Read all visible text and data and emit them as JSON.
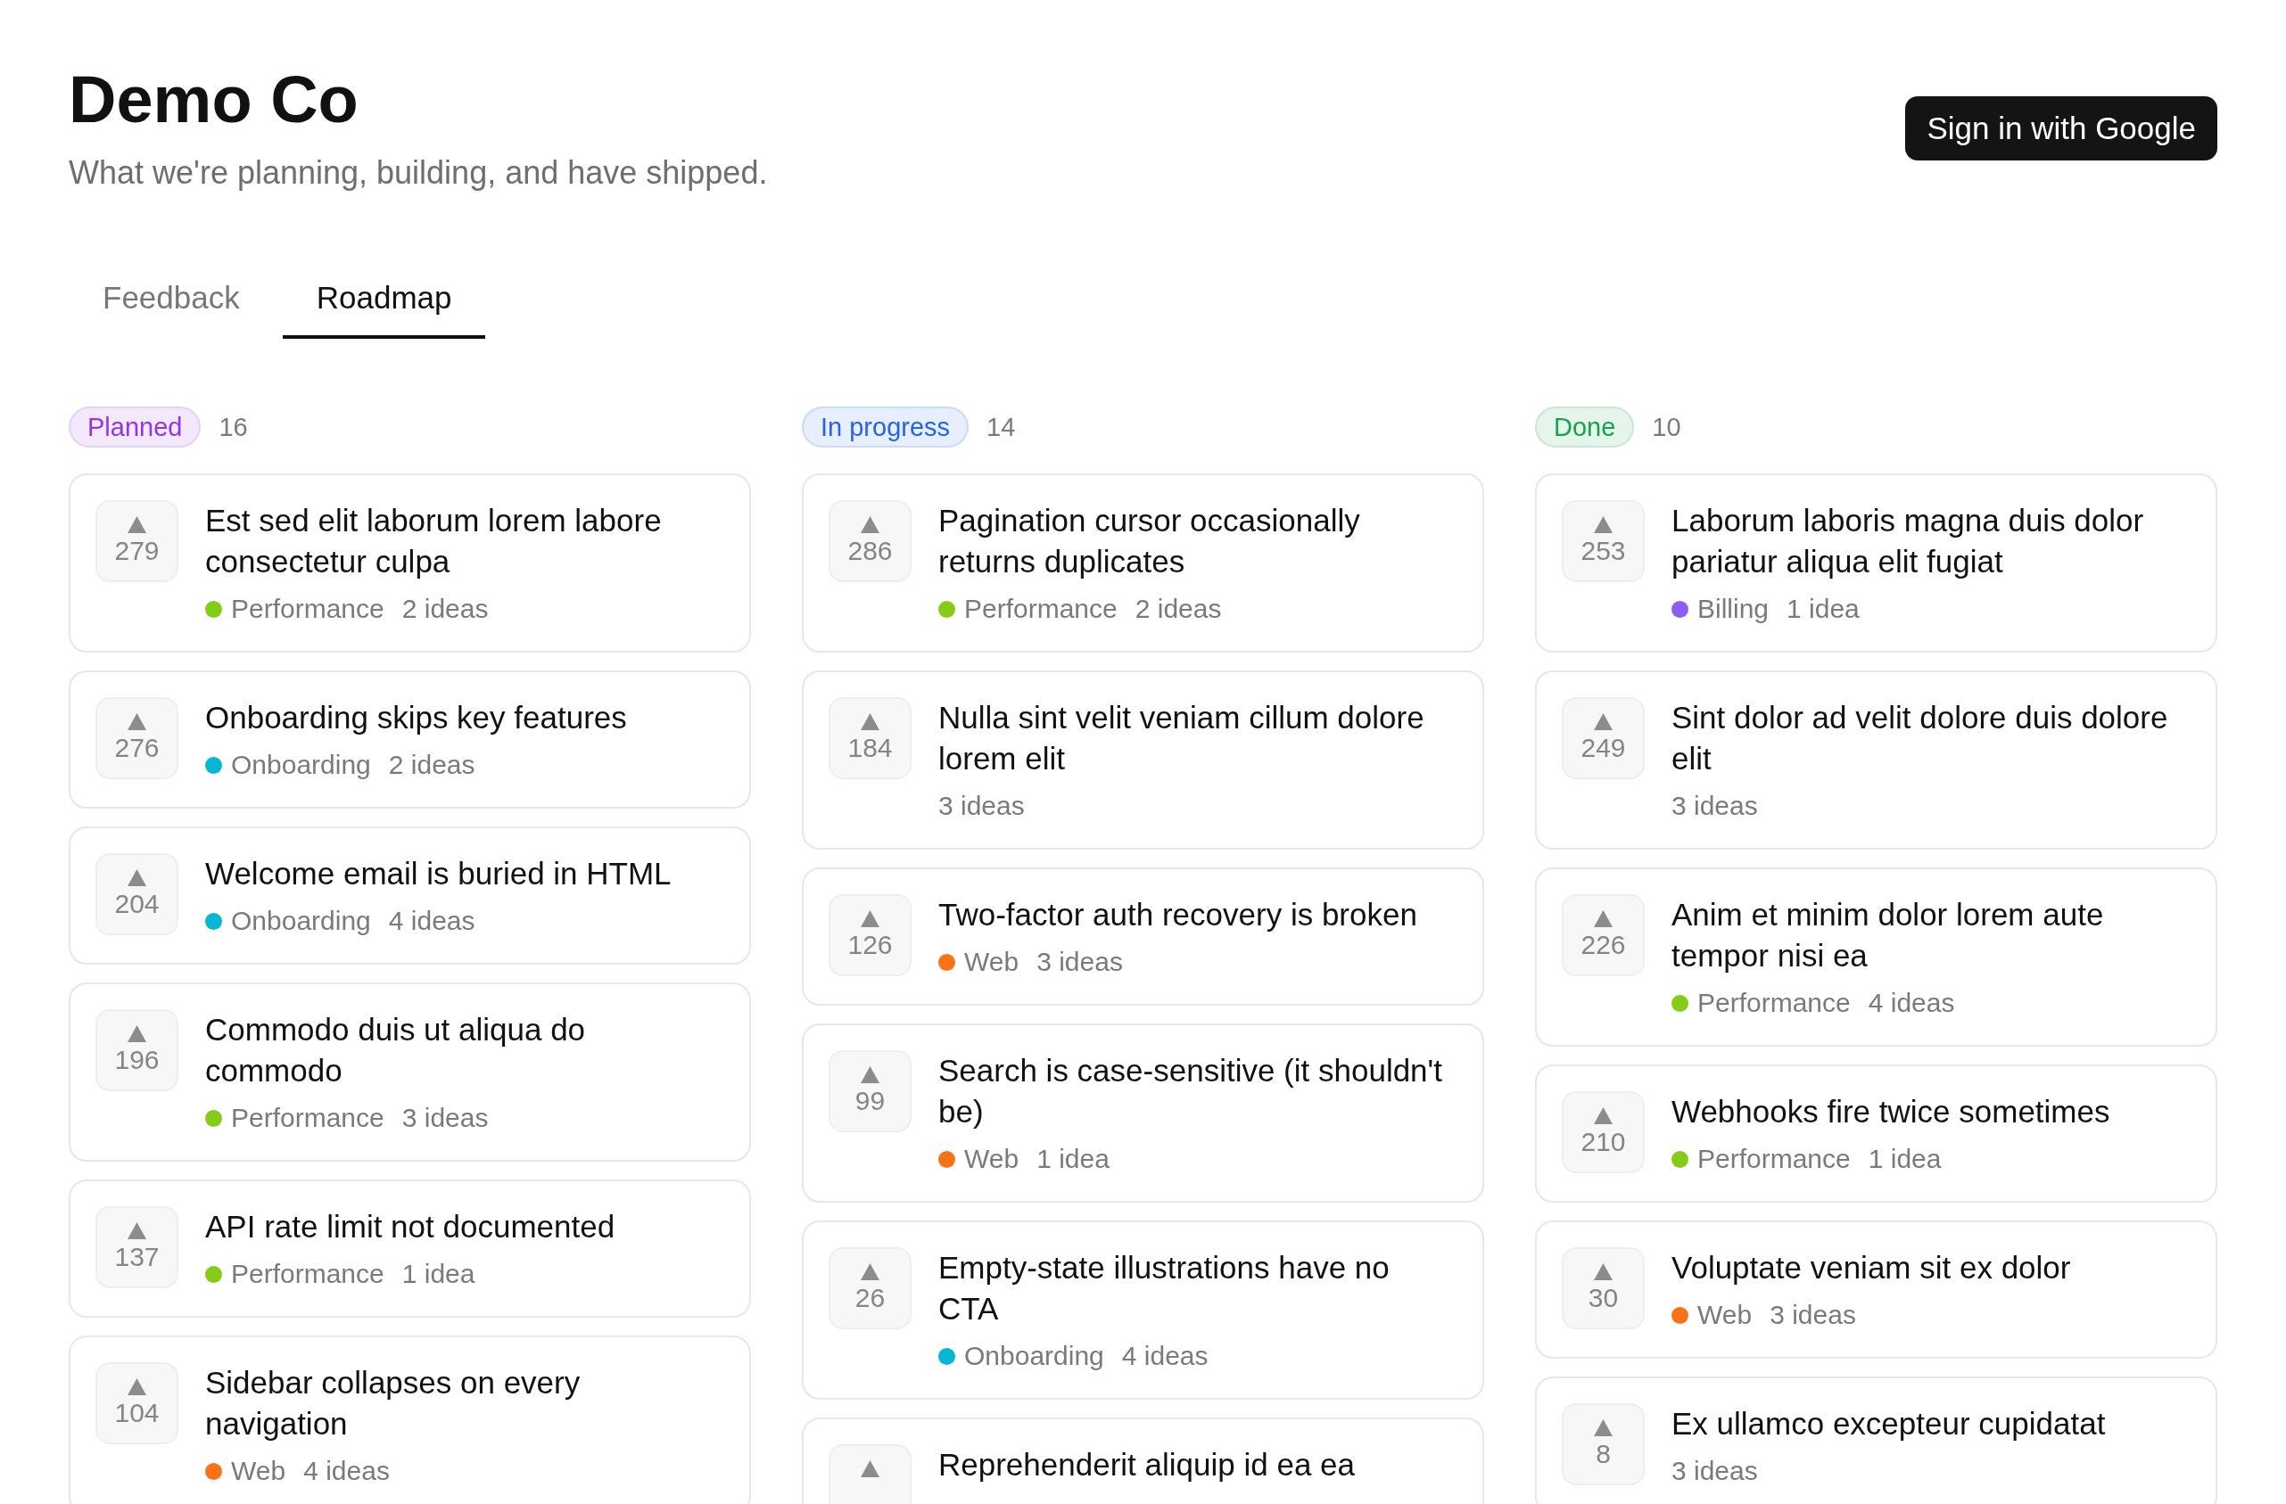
{
  "header": {
    "title": "Demo Co",
    "subtitle": "What we're planning, building, and have shipped.",
    "sign_in_button": "Sign in with Google"
  },
  "tabs": [
    {
      "label": "Feedback",
      "selected": false
    },
    {
      "label": "Roadmap",
      "selected": true
    }
  ],
  "columns": [
    {
      "status": "Planned",
      "color": "#9333ea",
      "count": "16",
      "cards": [
        {
          "votes": "279",
          "title": "Est sed elit laborum lorem labore consectetur culpa",
          "category": {
            "name": "Performance",
            "color": "#84cc16"
          },
          "ideas": "2 ideas"
        },
        {
          "votes": "276",
          "title": "Onboarding skips key features",
          "category": {
            "name": "Onboarding",
            "color": "#06b6d4"
          },
          "ideas": "2 ideas"
        },
        {
          "votes": "204",
          "title": "Welcome email is buried in HTML",
          "category": {
            "name": "Onboarding",
            "color": "#06b6d4"
          },
          "ideas": "4 ideas"
        },
        {
          "votes": "196",
          "title": "Commodo duis ut aliqua do commodo",
          "category": {
            "name": "Performance",
            "color": "#84cc16"
          },
          "ideas": "3 ideas"
        },
        {
          "votes": "137",
          "title": "API rate limit not documented",
          "category": {
            "name": "Performance",
            "color": "#84cc16"
          },
          "ideas": "1 idea"
        },
        {
          "votes": "104",
          "title": "Sidebar collapses on every navigation",
          "category": {
            "name": "Web",
            "color": "#f97316"
          },
          "ideas": "4 ideas"
        }
      ]
    },
    {
      "status": "In progress",
      "color": "#2563eb",
      "count": "14",
      "cards": [
        {
          "votes": "286",
          "title": "Pagination cursor occasionally returns duplicates",
          "category": {
            "name": "Performance",
            "color": "#84cc16"
          },
          "ideas": "2 ideas"
        },
        {
          "votes": "184",
          "title": "Nulla sint velit veniam cillum dolore lorem elit",
          "ideas": "3 ideas"
        },
        {
          "votes": "126",
          "title": "Two-factor auth recovery is broken",
          "category": {
            "name": "Web",
            "color": "#f97316"
          },
          "ideas": "3 ideas"
        },
        {
          "votes": "99",
          "title": "Search is case-sensitive (it shouldn't be)",
          "category": {
            "name": "Web",
            "color": "#f97316"
          },
          "ideas": "1 idea"
        },
        {
          "votes": "26",
          "title": "Empty-state illustrations have no CTA",
          "category": {
            "name": "Onboarding",
            "color": "#06b6d4"
          },
          "ideas": "4 ideas"
        },
        {
          "title": "Reprehenderit aliquip id ea ea"
        }
      ]
    },
    {
      "status": "Done",
      "color": "#16a34a",
      "count": "10",
      "cards": [
        {
          "votes": "253",
          "title": "Laborum laboris magna duis dolor pariatur aliqua elit fugiat",
          "category": {
            "name": "Billing",
            "color": "#8b5cf6"
          },
          "ideas": "1 idea"
        },
        {
          "votes": "249",
          "title": "Sint dolor ad velit dolore duis dolore elit",
          "ideas": "3 ideas"
        },
        {
          "votes": "226",
          "title": "Anim et minim dolor lorem aute tempor nisi ea",
          "category": {
            "name": "Performance",
            "color": "#84cc16"
          },
          "ideas": "4 ideas"
        },
        {
          "votes": "210",
          "title": "Webhooks fire twice sometimes",
          "category": {
            "name": "Performance",
            "color": "#84cc16"
          },
          "ideas": "1 idea"
        },
        {
          "votes": "30",
          "title": "Voluptate veniam sit ex dolor",
          "category": {
            "name": "Web",
            "color": "#f97316"
          },
          "ideas": "3 ideas"
        },
        {
          "votes": "8",
          "title": "Ex ullamco excepteur cupidatat",
          "ideas": "3 ideas"
        }
      ]
    }
  ]
}
